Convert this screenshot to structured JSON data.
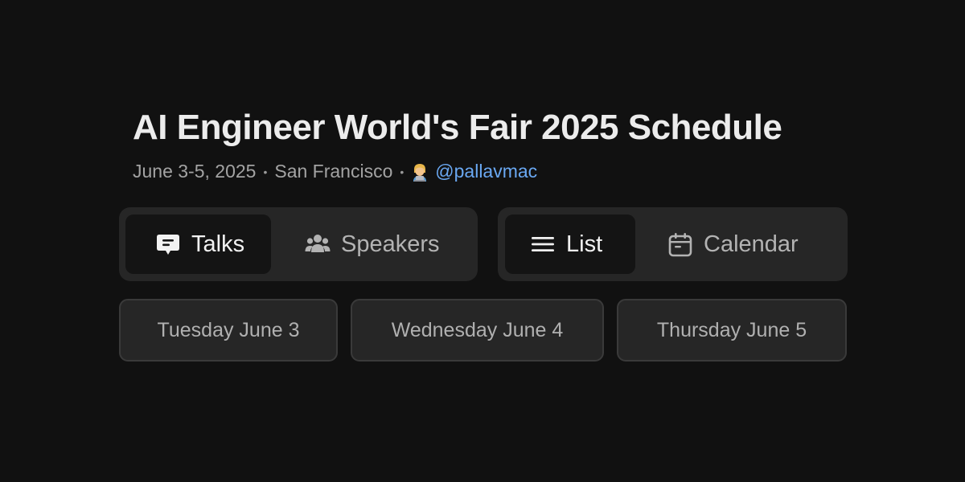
{
  "header": {
    "title": "AI Engineer World's Fair 2025 Schedule",
    "dates": "June 3-5, 2025",
    "separator": "•",
    "location": "San Francisco",
    "emoji_icon": "technologist-emoji-icon",
    "handle": "@pallavmac",
    "handle_color": "#6aa8f2"
  },
  "content_toggle": {
    "options": [
      {
        "label": "Talks",
        "icon": "speech-bubble-icon",
        "active": true
      },
      {
        "label": "Speakers",
        "icon": "people-group-icon",
        "active": false
      }
    ]
  },
  "view_toggle": {
    "options": [
      {
        "label": "List",
        "icon": "list-lines-icon",
        "active": true
      },
      {
        "label": "Calendar",
        "icon": "calendar-icon",
        "active": false
      }
    ]
  },
  "days": [
    {
      "label": "Tuesday June 3"
    },
    {
      "label": "Wednesday June 4"
    },
    {
      "label": "Thursday June 5"
    }
  ]
}
